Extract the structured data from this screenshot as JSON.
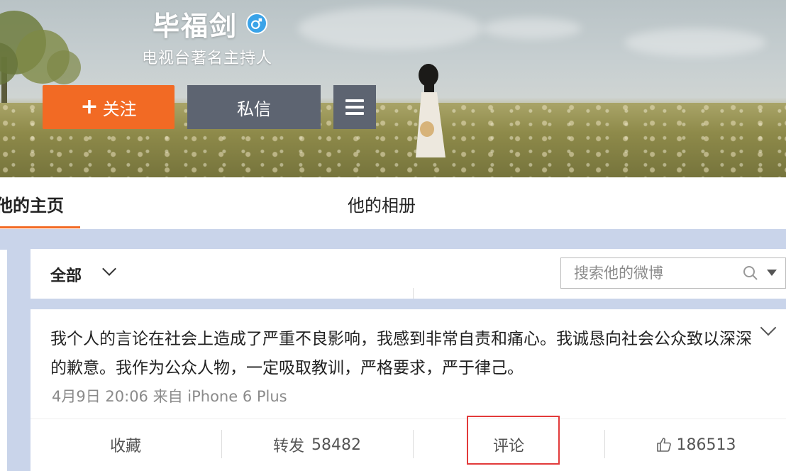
{
  "profile": {
    "name": "毕福剑",
    "description": "电视台著名主持人"
  },
  "actions": {
    "follow_label": "关注",
    "message_label": "私信"
  },
  "tabs": [
    {
      "label": "他的主页",
      "active": true
    },
    {
      "label": "他的相册",
      "active": false
    }
  ],
  "filter": {
    "selected": "全部",
    "search_placeholder": "搜索他的微博"
  },
  "post": {
    "text": "我个人的言论在社会上造成了严重不良影响，我感到非常自责和痛心。我诚恳向社会公众致以深深的歉意。我作为公众人物，一定吸取教训，严格要求，严于律己。",
    "meta": "4月9日 20:06 来自 iPhone 6 Plus",
    "favorite_label": "收藏",
    "repost_label": "转发",
    "repost_count": "58482",
    "comment_label": "评论",
    "like_count": "186513"
  },
  "colors": {
    "accent": "#f26a24",
    "dark_button": "#5d6471",
    "highlight": "#e23a3a"
  },
  "icons": [
    "gender-male-icon",
    "plus-icon",
    "menu-icon",
    "chevron-down-icon",
    "search-icon",
    "thumbs-up-icon"
  ]
}
